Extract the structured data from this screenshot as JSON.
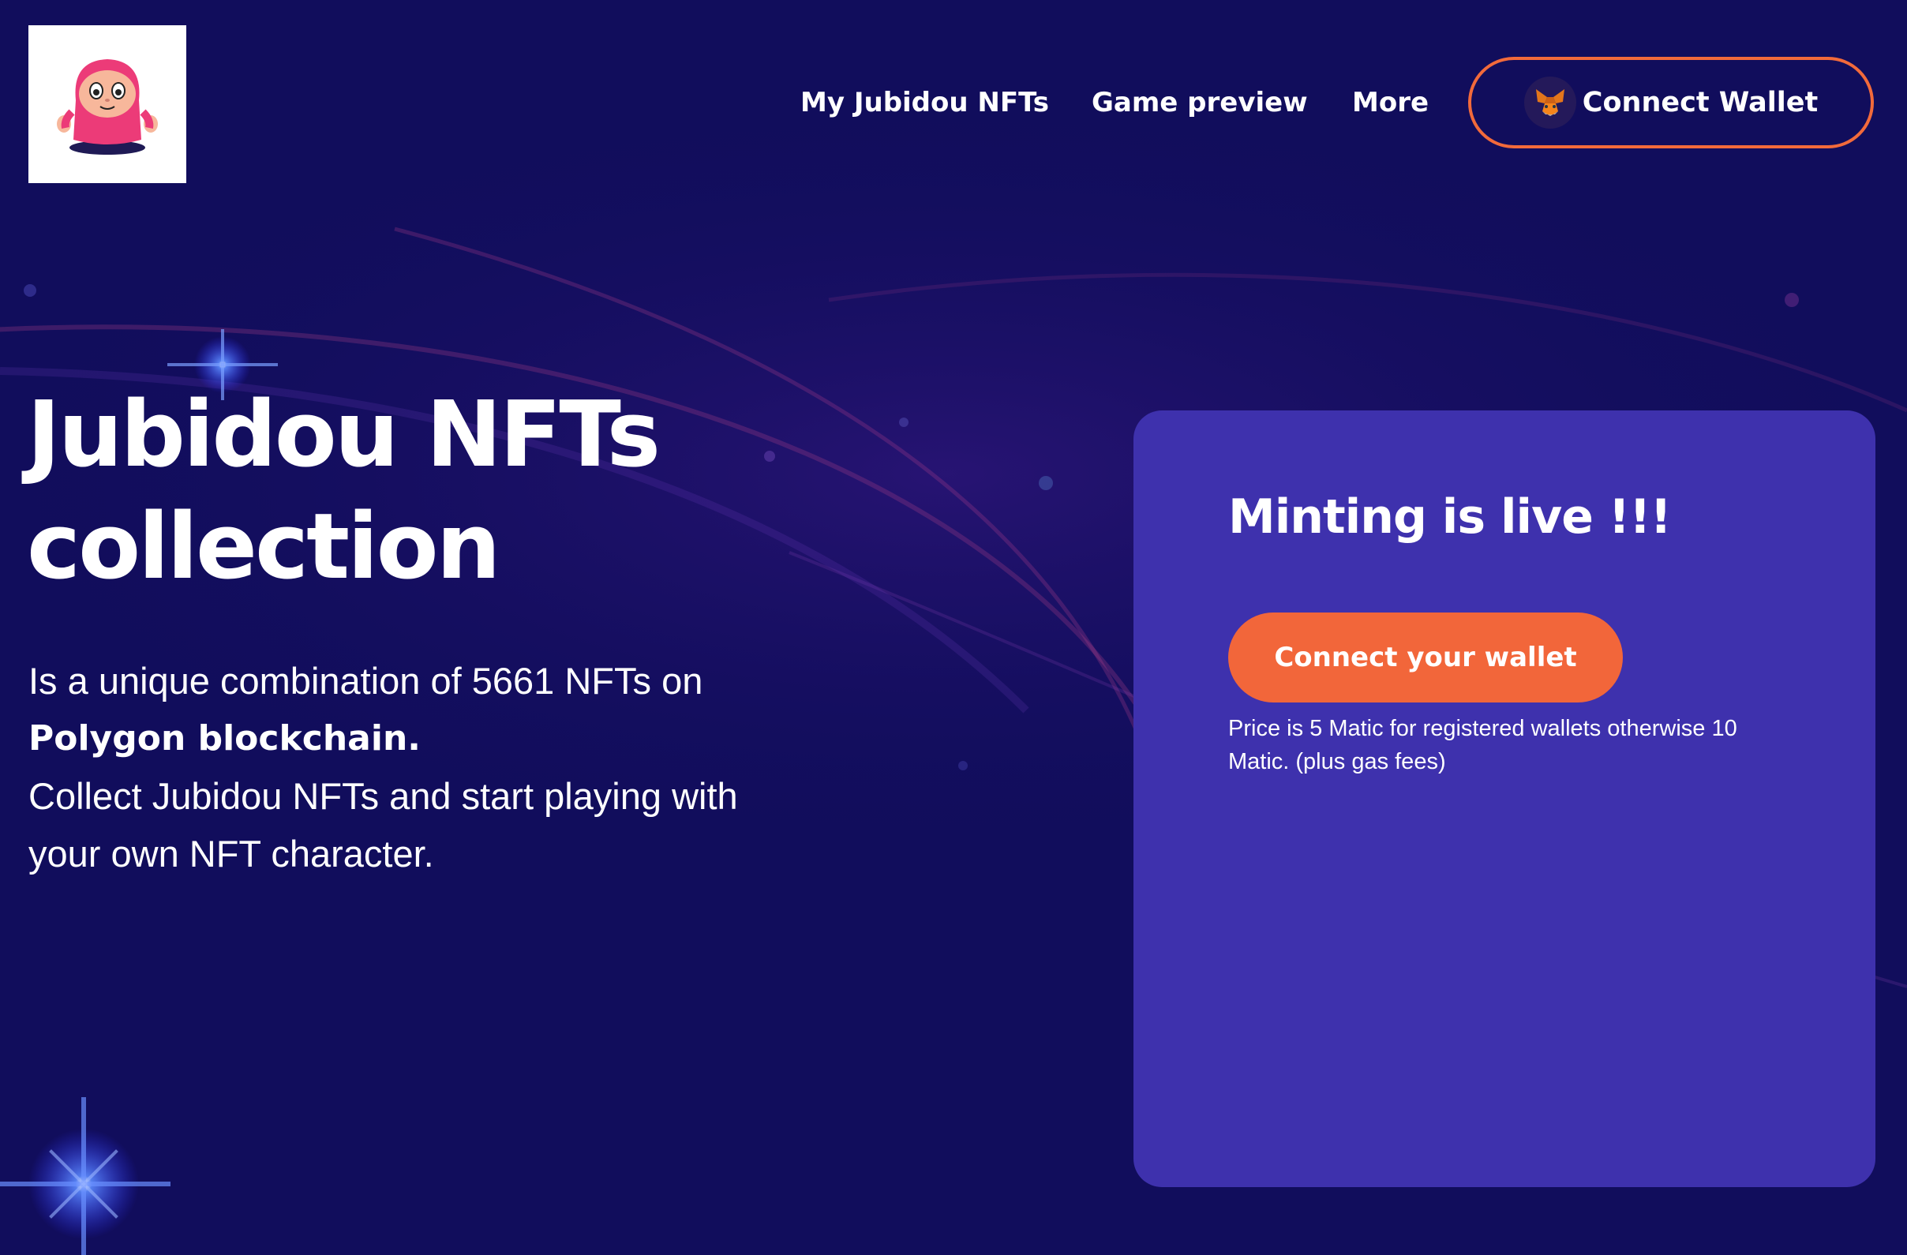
{
  "header": {
    "logo_icon": "jubidou-mascot-logo",
    "nav": [
      {
        "label": "My Jubidou NFTs"
      },
      {
        "label": "Game preview"
      },
      {
        "label": "More"
      }
    ],
    "connect_wallet": {
      "label": "Connect Wallet",
      "icon": "metamask-fox-icon",
      "border_color": "#f26a3b"
    }
  },
  "hero": {
    "title_line1": "Jubidou NFTs",
    "title_line2": "collection",
    "desc_line1": "Is a unique combination of 5661 NFTs on",
    "desc_bold": "Polygon blockchain.",
    "desc_line3": "Collect Jubidou NFTs and start playing with",
    "desc_line4": "your own NFT character."
  },
  "mint_card": {
    "title": "Minting is live !!!",
    "button_label": "Connect your wallet",
    "price_note": "Price is 5 Matic for registered wallets otherwise 10 Matic. (plus gas fees)"
  },
  "colors": {
    "background": "#110d5c",
    "card": "#3e31ad",
    "accent": "#f2663a",
    "text": "#ffffff"
  }
}
